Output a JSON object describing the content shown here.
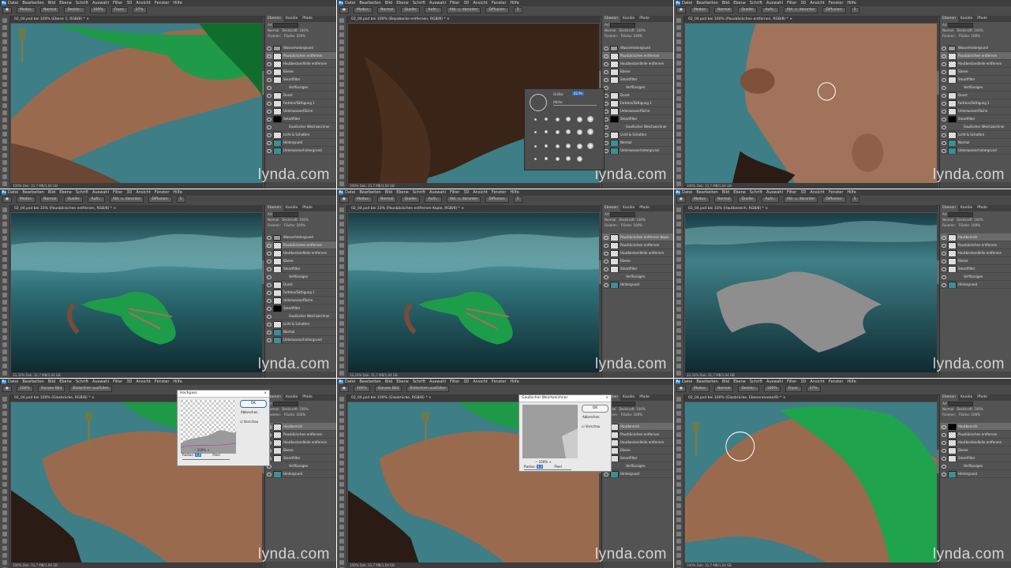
{
  "app": {
    "logo": "Ps",
    "brand_watermark": "lynda.com"
  },
  "menu": [
    "Datei",
    "Bearbeiten",
    "Bild",
    "Ebene",
    "Schrift",
    "Auswahl",
    "Filter",
    "3D",
    "Ansicht",
    "Fenster",
    "Hilfe"
  ],
  "panel_tabs": [
    "Ebenen",
    "Kanäle",
    "Pfade"
  ],
  "panel_controls": {
    "kind": "Art",
    "blend": "Normal",
    "opacity_label": "Deckkraft:",
    "opacity": "100%",
    "lock_label": "Fixieren:",
    "fill_label": "Fläche:",
    "fill": "100%"
  },
  "frames": [
    {
      "doc_tab": "02_04.psd bei 100% (Ebene 1, RGB/8) *",
      "options": [
        "Modus:",
        "Normal",
        "Deckkr.:",
        "100%",
        "Fluss:",
        "37%"
      ],
      "status": "100%   Dok: 31,7 MB/1,04 GB",
      "layers": [
        {
          "name": "Wasserhintergrund",
          "thumb": "fold"
        },
        {
          "name": "Pausbäckchen entfernen",
          "thumb": "chk",
          "selected": true
        },
        {
          "name": "Hautbestandteile entfernen",
          "thumb": "chk"
        },
        {
          "name": "Ebene",
          "thumb": "white"
        },
        {
          "name": "Smartfilter",
          "thumb": "white"
        },
        {
          "name": "Verflüssigen",
          "thumb": ""
        },
        {
          "name": "Dunst",
          "thumb": "white"
        },
        {
          "name": "Farbton/Sättigung 1",
          "thumb": "white"
        },
        {
          "name": "Unterwasserfläche",
          "thumb": "chk"
        },
        {
          "name": "Smartfilter",
          "thumb": "black"
        },
        {
          "name": "Gaußscher Weichzeichner",
          "thumb": ""
        },
        {
          "name": "Licht & Schatten",
          "thumb": "chk"
        },
        {
          "name": "Hintergrund",
          "thumb": "teal"
        },
        {
          "name": "Unterwasserhintergrund",
          "thumb": "teal"
        }
      ]
    },
    {
      "doc_tab": "02_04.psd bei 100% (Bepabacke entfernen, RGB/8) *",
      "options": [
        "Modus:",
        "Normal",
        "Quelle:",
        "Aufn.:",
        "Akt. u. darunter",
        "Diffusion:",
        "5"
      ],
      "status": "100%   Dok: 31,7 MB/1,04 GB",
      "brush_popup": {
        "size_label": "Größe:",
        "size": "42 Px",
        "hardness_label": "Härte:"
      },
      "layers": [
        {
          "name": "Wasserhintergrund",
          "thumb": "fold"
        },
        {
          "name": "Pausbäckchen entfernen",
          "thumb": "chk",
          "selected": true
        },
        {
          "name": "Hautbestandteile entfernen",
          "thumb": "chk"
        },
        {
          "name": "Ebene",
          "thumb": "white"
        },
        {
          "name": "Smartfilter",
          "thumb": "white"
        },
        {
          "name": "Verflüssigen",
          "thumb": ""
        },
        {
          "name": "Dunst",
          "thumb": "white"
        },
        {
          "name": "Farbton/Sättigung 1",
          "thumb": "white"
        },
        {
          "name": "Unterwasserfläche",
          "thumb": "chk"
        },
        {
          "name": "Smartfilter",
          "thumb": "black"
        },
        {
          "name": "Gaußscher Weichzeichner",
          "thumb": ""
        },
        {
          "name": "Licht & Schatten",
          "thumb": "chk"
        },
        {
          "name": "Normal",
          "thumb": "teal"
        },
        {
          "name": "Unterwasserhintergrund",
          "thumb": "teal"
        }
      ]
    },
    {
      "doc_tab": "02_04.psd bei 100% (Pausbäckchen entfernen, RGB/8) *",
      "options": [
        "Modus:",
        "Normal",
        "Quelle:",
        "Aufn.:",
        "Akt. u. darunter",
        "Diffusion:",
        "5"
      ],
      "status": "100%   Dok: 31,7 MB/1,04 GB",
      "layers": [
        {
          "name": "Wasserhintergrund",
          "thumb": "fold"
        },
        {
          "name": "Pausbäckchen entfernen",
          "thumb": "chk",
          "selected": true
        },
        {
          "name": "Hautbestandteile entfernen",
          "thumb": "chk"
        },
        {
          "name": "Ebene",
          "thumb": "white"
        },
        {
          "name": "Smartfilter",
          "thumb": "white"
        },
        {
          "name": "Verflüssigen",
          "thumb": ""
        },
        {
          "name": "Dunst",
          "thumb": "white"
        },
        {
          "name": "Farbton/Sättigung 1",
          "thumb": "white"
        },
        {
          "name": "Unterwasserfläche",
          "thumb": "chk"
        },
        {
          "name": "Smartfilter",
          "thumb": "black"
        },
        {
          "name": "Gaußscher Weichzeichner",
          "thumb": ""
        },
        {
          "name": "Licht & Schatten",
          "thumb": "chk"
        },
        {
          "name": "Normal",
          "thumb": "teal"
        },
        {
          "name": "Unterwasserhintergrund",
          "thumb": "teal"
        }
      ]
    },
    {
      "doc_tab": "02_04.psd bei 33% (Pausbäckchen entfernen, RGB/8) *",
      "options": [
        "Modus:",
        "Normal",
        "Quelle:",
        "Aufn.:",
        "Akt. u. darunter",
        "Diffusion:",
        "5"
      ],
      "status": "33,33%   Dok: 31,7 MB/1,04 GB",
      "layers": [
        {
          "name": "Wasserhintergrund",
          "thumb": "fold"
        },
        {
          "name": "Pausbäckchen entfernen",
          "thumb": "chk",
          "selected": true
        },
        {
          "name": "Hautbestandteile entfernen",
          "thumb": "chk"
        },
        {
          "name": "Ebene",
          "thumb": "white"
        },
        {
          "name": "Smartfilter",
          "thumb": "white"
        },
        {
          "name": "Verflüssigen",
          "thumb": ""
        },
        {
          "name": "Dunst",
          "thumb": "white"
        },
        {
          "name": "Farbton/Sättigung 1",
          "thumb": "white"
        },
        {
          "name": "Unterwasserfläche",
          "thumb": "chk"
        },
        {
          "name": "Smartfilter",
          "thumb": "black"
        },
        {
          "name": "Gaußscher Weichzeichner",
          "thumb": ""
        },
        {
          "name": "Licht & Schatten",
          "thumb": "chk"
        },
        {
          "name": "Normal",
          "thumb": "teal"
        },
        {
          "name": "Unterwasserhintergrund",
          "thumb": "teal"
        }
      ]
    },
    {
      "doc_tab": "02_04.psd bei 33% (Pausbäckchen entfernen Kopie, RGB/8) *",
      "options": [
        "Modus:",
        "Normal",
        "Quelle:",
        "Aufn.:",
        "Akt. u. darunter",
        "Diffusion:",
        "5"
      ],
      "status": "33,33%   Dok: 31,7 MB/1,04 GB",
      "layers": [
        {
          "name": "Pausbäckchen entfernen Kopie",
          "thumb": "chk",
          "selected": true
        },
        {
          "name": "Pausbäckchen entfernen",
          "thumb": "chk"
        },
        {
          "name": "Hautbestandteile entfernen",
          "thumb": "chk"
        },
        {
          "name": "Ebene",
          "thumb": "white"
        },
        {
          "name": "Smartfilter",
          "thumb": "white"
        },
        {
          "name": "Verflüssigen",
          "thumb": ""
        },
        {
          "name": "Hintergrund",
          "thumb": "teal"
        }
      ]
    },
    {
      "doc_tab": "02_04.psd bei 33% (Hautbereich, RGB/8) *",
      "options": [
        "Modus:",
        "Normal",
        "Quelle:",
        "Aufn.:",
        "Akt. u. darunter",
        "Diffusion:",
        "5"
      ],
      "status": "33,33%   Dok: 31,7 MB/1,04 GB",
      "layers": [
        {
          "name": "Hautbereich",
          "thumb": "chk",
          "selected": true
        },
        {
          "name": "Pausbäckchen entfernen",
          "thumb": "chk"
        },
        {
          "name": "Hautbestandteile entfernen",
          "thumb": "chk"
        },
        {
          "name": "Ebene",
          "thumb": "white"
        },
        {
          "name": "Smartfilter",
          "thumb": "white"
        },
        {
          "name": "Verflüssigen",
          "thumb": ""
        },
        {
          "name": "Hintergrund",
          "thumb": "teal"
        }
      ]
    },
    {
      "doc_tab": "02_04.psd bei 100% (Glasbrücke, RGB/8) *",
      "options": [
        "100%",
        "Ganzes Bild",
        "Bildschirm ausfüllen"
      ],
      "status": "100%   Dok: 31,7 MB/1,04 GB",
      "dialog": {
        "title": "Hochpass",
        "ok": "OK",
        "cancel": "Abbrechen",
        "preview": "Vorschau",
        "zoom": "100%",
        "radius_label": "Radius:",
        "radius": "4,0",
        "unit": "Pixel"
      },
      "layers": [
        {
          "name": "Hautbereich",
          "thumb": "chk",
          "selected": true
        },
        {
          "name": "Pausbäckchen entfernen",
          "thumb": "chk"
        },
        {
          "name": "Hautbestandteile entfernen",
          "thumb": "chk"
        },
        {
          "name": "Ebene",
          "thumb": "white"
        },
        {
          "name": "Smartfilter",
          "thumb": "white"
        },
        {
          "name": "Verflüssigen",
          "thumb": ""
        },
        {
          "name": "Hintergrund",
          "thumb": "teal"
        }
      ]
    },
    {
      "doc_tab": "02_04.psd bei 100% (Glasbrücke, RGB/8) *",
      "options": [
        "100%",
        "Ganzes Bild",
        "Bildschirm ausfüllen"
      ],
      "status": "100%   Dok: 31,7 MB/1,04 GB",
      "dialog": {
        "title": "Gaußscher Weichzeichner",
        "ok": "OK",
        "cancel": "Abbrechen",
        "preview": "Vorschau",
        "zoom": "100%",
        "radius_label": "Radius:",
        "radius": "4,0",
        "unit": "Pixel"
      },
      "layers": [
        {
          "name": "Hautbereich",
          "thumb": "chk",
          "selected": true
        },
        {
          "name": "Pausbäckchen entfernen",
          "thumb": "chk"
        },
        {
          "name": "Hautbestandteile entfernen",
          "thumb": "chk"
        },
        {
          "name": "Ebene",
          "thumb": "white"
        },
        {
          "name": "Smartfilter",
          "thumb": "white"
        },
        {
          "name": "Verflüssigen",
          "thumb": ""
        },
        {
          "name": "Hintergrund",
          "thumb": "teal"
        }
      ]
    },
    {
      "doc_tab": "02_04.psd bei 100% (Glasbrücke, Ebenenmaske/8) *",
      "options": [
        "Modus:",
        "Normal",
        "Deckkr.:",
        "100%",
        "Fluss:",
        "37%"
      ],
      "status": "100%   Dok: 31,7 MB/1,04 GB",
      "layers": [
        {
          "name": "Hautbereich",
          "thumb": "black",
          "selected": true
        },
        {
          "name": "Pausbäckchen entfernen",
          "thumb": "chk"
        },
        {
          "name": "Hautbestandteile entfernen",
          "thumb": "chk"
        },
        {
          "name": "Ebene",
          "thumb": "white"
        },
        {
          "name": "Smartfilter",
          "thumb": "white"
        },
        {
          "name": "Verflüssigen",
          "thumb": ""
        },
        {
          "name": "Hintergrund",
          "thumb": "teal"
        }
      ]
    }
  ]
}
